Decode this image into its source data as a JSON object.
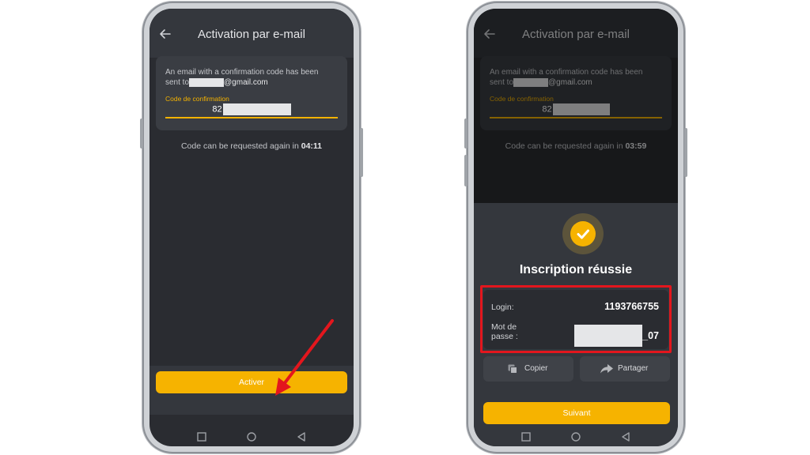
{
  "left_phone": {
    "header": {
      "title": "Activation par e-mail"
    },
    "email_card": {
      "message_line1": "An email with a confirmation code has been",
      "message_prefix": "sent to",
      "email_domain": "@gmail.com",
      "code_label": "Code de confirmation",
      "code_value": "82"
    },
    "timer": {
      "text": "Code can be requested again in ",
      "time": "04:11"
    },
    "activate_button": {
      "label": "Activer"
    }
  },
  "right_phone": {
    "header": {
      "title": "Activation par e-mail"
    },
    "email_card": {
      "message_line1": "An email with a confirmation code has been",
      "message_prefix": "sent to",
      "email_domain": "@gmail.com",
      "code_label": "Code de confirmation",
      "code_value": "82"
    },
    "timer": {
      "text": "Code can be requested again in ",
      "time": "03:59"
    },
    "success_sheet": {
      "icon": "check-icon",
      "title": "Inscription réussie",
      "login_label": "Login:",
      "login_value": "1193766755",
      "password_label_line1": "Mot de",
      "password_label_line2": "passe :",
      "password_suffix": "_07",
      "copy_label": "Copier",
      "share_label": "Partager",
      "next_label": "Suivant"
    }
  },
  "colors": {
    "accent_yellow": "#f6b300",
    "background_dark": "#2a2c31",
    "highlight_red": "#e3161d"
  }
}
